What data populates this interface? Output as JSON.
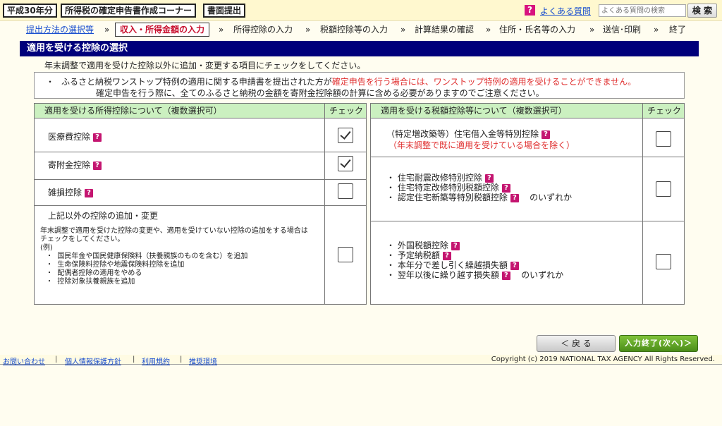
{
  "topbar": {
    "year_tag": "平成30年分",
    "corner_tag": "所得税の確定申告書作成コーナー",
    "mode_tag": "書面提出",
    "faq_icon": "?",
    "faq_link": "よくある質問",
    "faq_search_placeholder": "よくある質問の検索",
    "faq_search_button": "検 索"
  },
  "steps": {
    "items": [
      "提出方法の選択等",
      "収入・所得金額の入力",
      "所得控除の入力",
      "税額控除等の入力",
      "計算結果の確認",
      "住所・氏名等の入力",
      "送信･印刷",
      "終了"
    ],
    "separator": "»"
  },
  "page_title": "適用を受ける控除の選択",
  "intro": "年末調整で適用を受けた控除以外に追加・変更する項目にチェックをしてください。",
  "notice": {
    "bullet": "・",
    "line1_a": "ふるさと納税ワンストップ特例の適用に関する申請書を提出された方が",
    "line1_b": "確定申告を行う場合には、ワンストップ特例の適用を受けることができません。",
    "line2": "確定申告を行う際に、全てのふるさと納税の金額を寄附金控除額の計算に含める必要がありますのでご注意ください。"
  },
  "left_panel": {
    "header": "適用を受ける所得控除について（複数選択可）",
    "check_header": "チェック",
    "rows": [
      {
        "label": "医療費控除",
        "checked": true
      },
      {
        "label": "寄附金控除",
        "checked": true
      },
      {
        "label": "雑損控除",
        "checked": false
      }
    ],
    "other": {
      "title": "上記以外の控除の追加・変更",
      "desc1": "年末調整で適用を受けた控除の変更や、適用を受けていない控除の追加をする場合は",
      "desc2": "チェックをしてください。",
      "example_label": "(例)",
      "examples": [
        "国民年金や国民健康保険料（扶養親族のものを含む）を追加",
        "生命保険料控除や地震保険料控除を追加",
        "配偶者控除の適用をやめる",
        "控除対象扶養親族を追加"
      ],
      "checked": false
    }
  },
  "right_panel": {
    "header": "適用を受ける税額控除等について（複数選択可）",
    "check_header": "チェック",
    "row1": {
      "label": "（特定増改築等）住宅借入金等特別控除",
      "note": "（年末調整で既に適用を受けている場合を除く）",
      "checked": false
    },
    "row2": {
      "items": [
        "住宅耐震改修特別控除",
        "住宅特定改修特別税額控除",
        "認定住宅新築等特別税額控除"
      ],
      "suffix": "のいずれか",
      "checked": false
    },
    "row3": {
      "items": [
        "外国税額控除",
        "予定納税額",
        "本年分で差し引く繰越損失額",
        "翌年以後に繰り越す損失額"
      ],
      "suffix": "のいずれか",
      "checked": false
    }
  },
  "buttons": {
    "back": "＜ 戻 る",
    "next": "入力終了(次へ)＞"
  },
  "footer": {
    "links": [
      "お問い合わせ",
      "個人情報保護方針",
      "利用規約",
      "推奨環境"
    ],
    "separator": "|",
    "copyright": "Copyright (c) 2019 NATIONAL TAX AGENCY All Rights Reserved."
  },
  "icons": {
    "help": "?",
    "bullet": "・"
  },
  "colors": {
    "title_bar": "#00007b",
    "header_green": "#cbf0c0",
    "warning_red": "#e03030",
    "next_button": "#5a9e22",
    "help_icon": "#c41570"
  }
}
